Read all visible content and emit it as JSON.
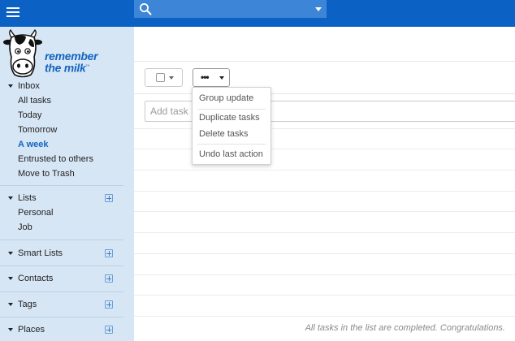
{
  "topbar": {
    "menu_icon": "hamburger-menu-icon",
    "search": {
      "icon": "search-icon",
      "placeholder": "",
      "value": ""
    },
    "accent_color": "#0b62c4"
  },
  "brand": {
    "logo_line1": "remember",
    "logo_line2": "the milk",
    "trademark": "™"
  },
  "sidebar": {
    "inbox": {
      "label": "Inbox",
      "items": [
        "All tasks",
        "Today",
        "Tomorrow",
        "A week",
        "Entrusted to others",
        "Move to Trash"
      ],
      "active": "A week"
    },
    "lists": {
      "label": "Lists",
      "items": [
        "Personal",
        "Job"
      ]
    },
    "smart_lists": {
      "label": "Smart Lists"
    },
    "contacts": {
      "label": "Contacts"
    },
    "tags": {
      "label": "Tags"
    },
    "places": {
      "label": "Places"
    }
  },
  "toolbar": {
    "select_icon": "checkbox-icon",
    "more_label": "•••"
  },
  "add_task": {
    "placeholder": "Add task ..."
  },
  "more_menu": {
    "items": [
      "Group update",
      "Duplicate tasks",
      "Delete tasks",
      "Undo last action"
    ]
  },
  "status_text": "All tasks in the list are completed. Congratulations."
}
